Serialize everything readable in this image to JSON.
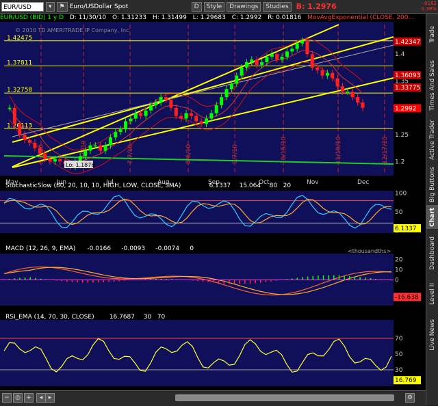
{
  "toolbar": {
    "symbol": "EUR/USD",
    "description": "Euro/USDollar Spot",
    "buttons": [
      "D",
      "Style",
      "Drawings",
      "Studies"
    ],
    "bid_label": "B: 1.2976",
    "change_top": "-.0182",
    "change_bottom": "-1.36%"
  },
  "info": {
    "title": "EUR/USD (BID) 1 y D",
    "date": "D: 11/30/10",
    "open": "O: 1.31233",
    "high": "H: 1.31499",
    "low": "L: 1.29683",
    "close": "C: 1.2992",
    "range": "R: 0.01816",
    "study": "MovAvgExponential (CLOSE, 200..."
  },
  "watermark": "© 2010 TD AMERITRADE IP Company, Inc.",
  "side_tabs": [
    "Trade",
    "Times And Sales",
    "Active Trader",
    "Big Buttons",
    "Chart",
    "Dashboard",
    "Level II",
    "Live News"
  ],
  "active_tab": "Chart",
  "chart_data": [
    {
      "type": "line",
      "title": "EUR/USD (BID) 1 y D",
      "x_labels": [
        "May",
        "Jun",
        "Jul",
        "Aug",
        "Sep",
        "Oct",
        "Nov",
        "Dec"
      ],
      "y_ticks": [
        1.2,
        1.25,
        1.3,
        1.35,
        1.4
      ],
      "ylim": [
        1.18,
        1.455
      ],
      "closes": [
        1.3,
        1.27,
        1.25,
        1.24,
        1.235,
        1.225,
        1.215,
        1.205,
        1.2,
        1.205,
        1.2,
        1.195,
        1.19,
        1.2,
        1.21,
        1.22,
        1.23,
        1.23,
        1.22,
        1.23,
        1.245,
        1.255,
        1.26,
        1.275,
        1.28,
        1.29,
        1.285,
        1.295,
        1.305,
        1.31,
        1.32,
        1.315,
        1.3,
        1.285,
        1.28,
        1.29,
        1.285,
        1.275,
        1.27,
        1.28,
        1.29,
        1.305,
        1.32,
        1.335,
        1.345,
        1.36,
        1.375,
        1.385,
        1.39,
        1.38,
        1.385,
        1.395,
        1.4,
        1.39,
        1.395,
        1.405,
        1.41,
        1.42,
        1.425,
        1.4,
        1.375,
        1.37,
        1.36,
        1.365,
        1.355,
        1.34,
        1.33,
        1.33,
        1.32,
        1.31,
        1.3
      ],
      "horizontal_levels": [
        {
          "label": "1.42475",
          "value": 1.42475,
          "color": "#ffff00"
        },
        {
          "label": "1.37811",
          "value": 1.37811,
          "color": "#ffff00"
        },
        {
          "label": "1.32758",
          "value": 1.32758,
          "color": "#ffff00"
        },
        {
          "label": "1.26113",
          "value": 1.26113,
          "color": "#ffff00"
        }
      ],
      "price_tags": [
        {
          "label": "1.42347",
          "value": 1.42347,
          "color": "#cc0000"
        },
        {
          "label": "1.36093",
          "value": 1.36093,
          "color": "#cc0000"
        },
        {
          "label": "1.33775",
          "value": 1.33775,
          "color": "#cc0000"
        },
        {
          "label": "1.2992",
          "value": 1.2992,
          "color": "#ff0000"
        }
      ],
      "vline_labels": [
        "5/3/10",
        "6/10/10",
        "7/7/10",
        "8/6/10",
        "9/7/10",
        "10/15/10",
        "11/19/10",
        "12/17/10"
      ],
      "low_label": "Lo: 1.1876"
    },
    {
      "type": "line",
      "title": "StochasticSlow (80, 20, 10, 10, HIGH, LOW, CLOSE, SMA)",
      "values_text": [
        "6.1337",
        "15.064",
        "80",
        "20"
      ],
      "y_ticks": [
        100,
        50,
        0
      ],
      "levels": [
        80,
        20
      ],
      "last": "6.1337"
    },
    {
      "type": "bar",
      "title": "MACD (12, 26, 9, EMA)",
      "values_text": [
        "-0.0166",
        "-0.0093",
        "-0.0074",
        "0"
      ],
      "unit_note": "<thousandths>",
      "y_ticks": [
        20,
        10,
        0
      ],
      "last": "-16.638"
    },
    {
      "type": "line",
      "title": "RSI_EMA (14, 70, 30, CLOSE)",
      "values_text": [
        "16.7687",
        "30",
        "70"
      ],
      "y_ticks": [
        70,
        50,
        30
      ],
      "levels": [
        70,
        30
      ],
      "last": "16.769"
    }
  ]
}
